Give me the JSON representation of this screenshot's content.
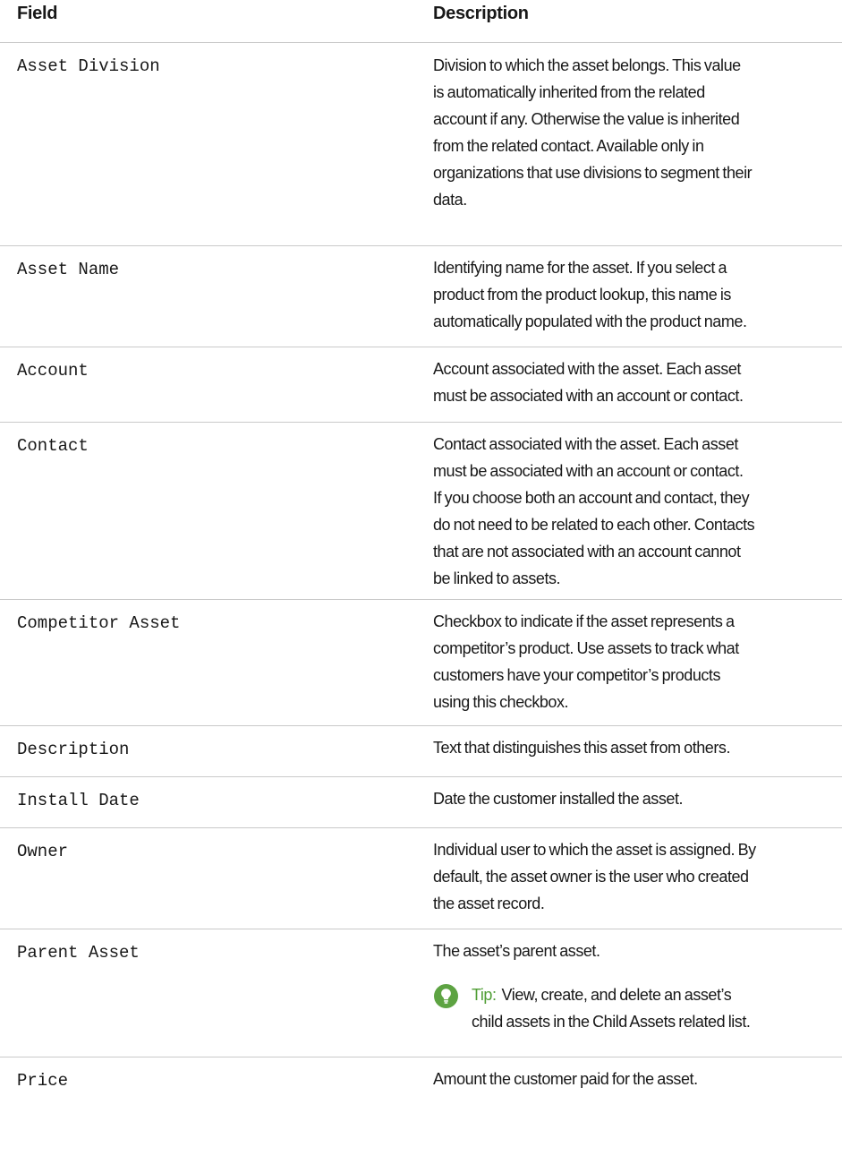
{
  "header": {
    "field": "Field",
    "description": "Description"
  },
  "rows": [
    {
      "field": "Asset Division",
      "lines": [
        "Division to which the asset belongs. This value",
        "is automatically inherited from the related",
        "account if any. Otherwise the value is inherited",
        "from the related contact. Available only in",
        "organizations that use divisions to segment their",
        "data."
      ]
    },
    {
      "field": "Asset Name",
      "lines": [
        "Identifying name for the asset. If you select a",
        "product from the product lookup, this name is",
        "automatically populated with the product name."
      ]
    },
    {
      "field": "Account",
      "lines": [
        "Account associated with the asset. Each asset",
        "must be associated with an account or contact."
      ]
    },
    {
      "field": "Contact",
      "lines": [
        "Contact associated with the asset. Each asset",
        "must be associated with an account or contact.",
        "If you choose both an account and contact, they",
        "do not need to be related to each other. Contacts",
        "that are not associated with an account cannot",
        "be linked to assets."
      ]
    },
    {
      "field": "Competitor Asset",
      "lines": [
        "Checkbox to indicate if the asset represents a",
        "competitor’s product. Use assets to track what",
        "customers have your competitor’s products",
        "using this checkbox."
      ]
    },
    {
      "field": "Description",
      "lines": [
        "Text that distinguishes this asset from others."
      ]
    },
    {
      "field": "Install Date",
      "lines": [
        "Date the customer installed the asset."
      ]
    },
    {
      "field": "Owner",
      "lines": [
        "Individual user to which the asset is assigned. By",
        "default, the asset owner is the user who created",
        "the asset record."
      ]
    },
    {
      "field": "Parent Asset",
      "lines": [
        "The asset’s parent asset."
      ],
      "tip": {
        "label": "Tip:",
        "lines": [
          "View, create, and delete an asset’s",
          "child assets in the Child Assets related list."
        ]
      }
    },
    {
      "field": "Price",
      "lines": [
        "Amount the customer paid for the asset."
      ]
    }
  ],
  "colors": {
    "tip_green": "#5da342",
    "rule": "#c9c9c9"
  },
  "icons": {
    "tip": "lightbulb-icon"
  }
}
